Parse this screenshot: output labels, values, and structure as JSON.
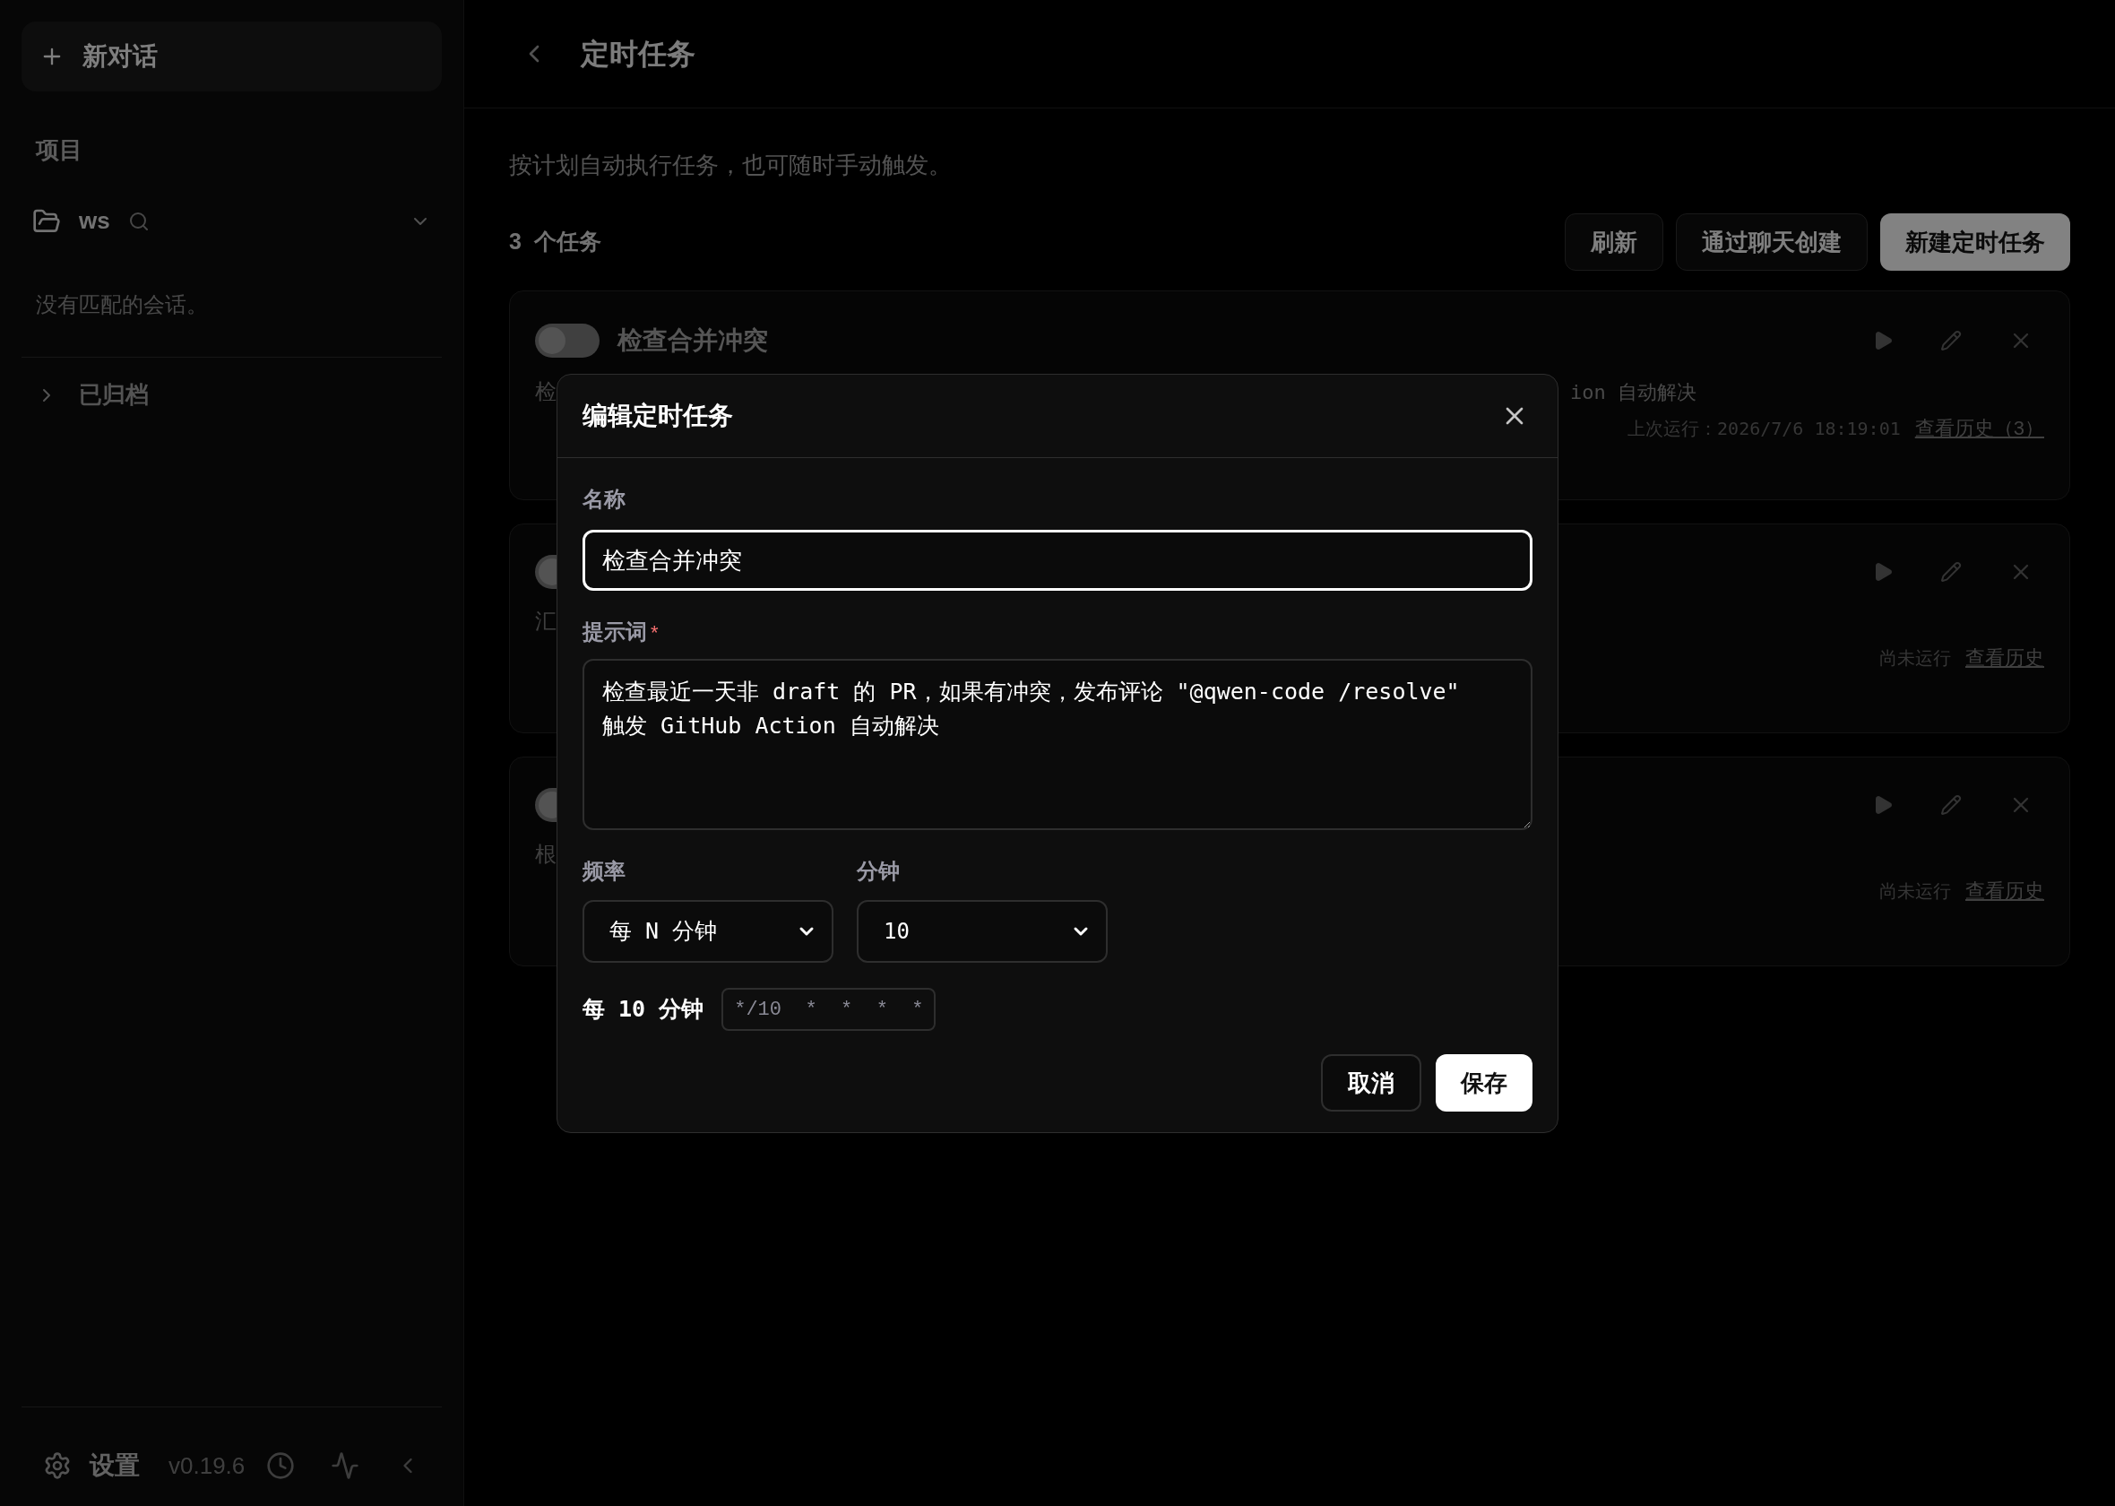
{
  "sidebar": {
    "new_chat": "新对话",
    "section_title": "项目",
    "project": {
      "name": "ws",
      "expanded": true
    },
    "empty_text": "没有匹配的会话。",
    "archived": {
      "label": "已归档",
      "expanded": false
    },
    "settings": "设置",
    "version": "v0.19.6"
  },
  "header": {
    "title": "定时任务"
  },
  "intro": "按计划自动执行任务，也可随时手动触发。",
  "task_count": {
    "number": "3",
    "label": "个任务"
  },
  "actions": [
    "刷新",
    "通过聊天创建",
    "新建定时任务"
  ],
  "tasks": [
    {
      "title": "检查合并冲突",
      "enabled": false,
      "description_start": "检",
      "description_end": "ion 自动解决",
      "last_run": "上次运行：2026/7/6 18:19:01",
      "history": "查看历史（3）"
    },
    {
      "enabled": false,
      "description_start": "汇",
      "last_run": "尚未运行",
      "history": "查看历史"
    },
    {
      "enabled": false,
      "description_start": "根",
      "last_run": "尚未运行",
      "history": "查看历史"
    }
  ],
  "dialog": {
    "title": "编辑定时任务",
    "fields": {
      "name_label": "名称",
      "name_value": "检查合并冲突",
      "prompt_label": "提示词",
      "prompt_required": "*",
      "prompt_value": "检查最近一天非 draft 的 PR，如果有冲突，发布评论 \"@qwen-code /resolve\"\n触发 GitHub Action 自动解决",
      "frequency_label": "频率",
      "frequency_value": "每 N 分钟",
      "minutes_label": "分钟",
      "minutes_value": "10"
    },
    "summary": "每 10 分钟",
    "cron": "*/10 * * * *",
    "cancel": "取消",
    "save": "保存"
  }
}
